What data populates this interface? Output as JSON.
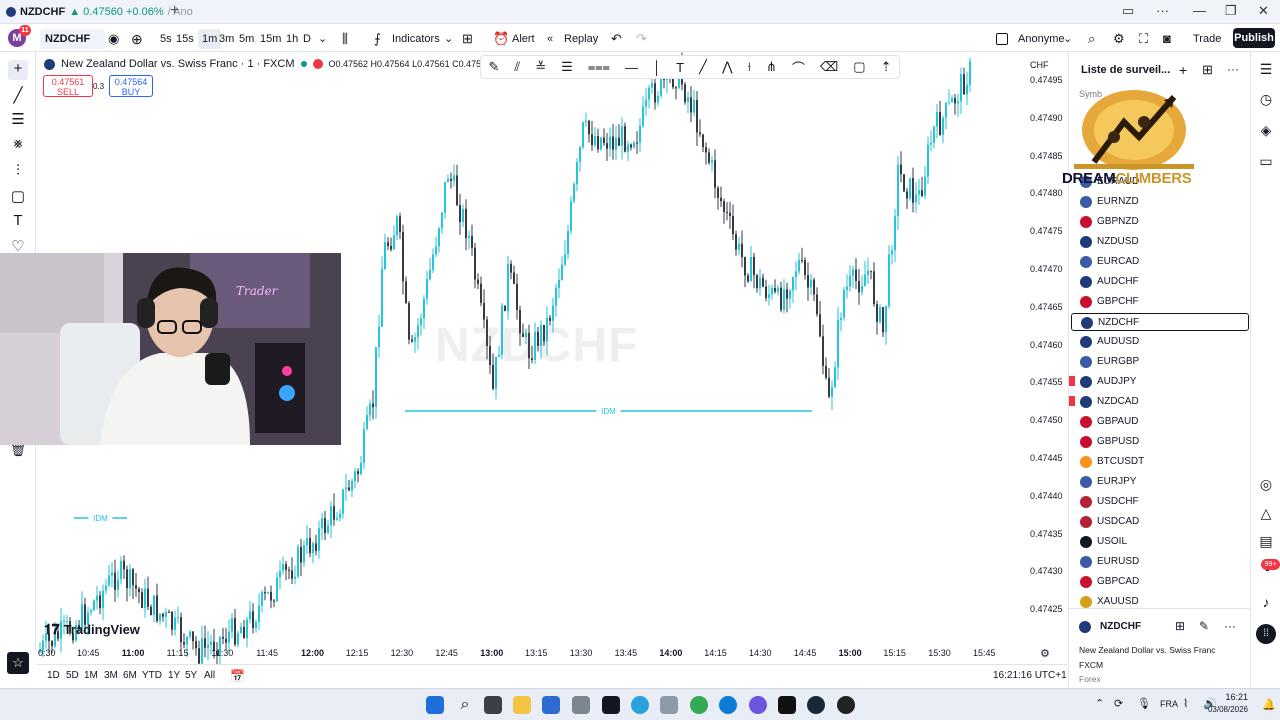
{
  "browser": {
    "tab_symbol": "NZDCHF",
    "tab_change": "▲ 0.47560 +0.06%",
    "tab_suffix": "/ Ano"
  },
  "toolbar": {
    "avatar_letter": "M",
    "avatar_badge": "11",
    "symbol": "NZDCHF",
    "intervals": [
      "5s",
      "15s",
      "1m",
      "3m",
      "5m",
      "15m",
      "1h",
      "D"
    ],
    "selected_interval": "1m",
    "indicators_label": "Indicators",
    "alert_label": "Alert",
    "replay_label": "Replay",
    "layout_name": "Anonyme",
    "trade_label": "Trade",
    "publish_label": "Publish"
  },
  "legend": {
    "title": "New Zealand Dollar vs. Swiss Franc · 1 · FXCM",
    "ohlc": "O0.47562 H0.47564 L0.47561 C0.47561 -0",
    "sell_price": "0.47561",
    "sell_label": "SELL",
    "spread": "0.3",
    "buy_price": "0.47564",
    "buy_label": "BUY"
  },
  "chart": {
    "watermark": "NZDCHF",
    "currency": "CHF",
    "price_labels": [
      "0.47495",
      "0.47490",
      "0.47485",
      "0.47480",
      "0.47475",
      "0.47470",
      "0.47465",
      "0.47460",
      "0.47455",
      "0.47450",
      "0.47445",
      "0.47440",
      "0.47435",
      "0.47430",
      "0.47425"
    ],
    "time_labels": [
      "0:30",
      "10:45",
      "11:00",
      "11:15",
      "11:30",
      "11:45",
      "12:00",
      "12:15",
      "12:30",
      "12:45",
      "13:00",
      "13:15",
      "13:30",
      "13:45",
      "14:00",
      "14:15",
      "14:30",
      "14:45",
      "15:00",
      "15:15",
      "15:30",
      "15:45"
    ],
    "idm_label_1": "IDM",
    "idm_label_2": "IDM",
    "brand": "TradingView",
    "bull_color": "#26c6da",
    "bear_color": "#363a45"
  },
  "bottombar": {
    "ranges": [
      "1D",
      "5D",
      "1M",
      "3M",
      "6M",
      "YTD",
      "1Y",
      "5Y",
      "All"
    ],
    "clock": "16:21:16 UTC+1"
  },
  "watchlist": {
    "title": "Liste de surveil...",
    "symbol_header": "Symb",
    "items": [
      {
        "symbol": "EURAUD",
        "flag": "#3b5ba5",
        "marked": false
      },
      {
        "symbol": "EURNZD",
        "flag": "#3b5ba5",
        "marked": false
      },
      {
        "symbol": "GBPNZD",
        "flag": "#c8102e",
        "marked": false
      },
      {
        "symbol": "NZDUSD",
        "flag": "#1f3b7a",
        "marked": false
      },
      {
        "symbol": "EURCAD",
        "flag": "#3b5ba5",
        "marked": false
      },
      {
        "symbol": "AUDCHF",
        "flag": "#1f3b7a",
        "marked": false
      },
      {
        "symbol": "GBPCHF",
        "flag": "#c8102e",
        "marked": false
      },
      {
        "symbol": "NZDCHF",
        "flag": "#1f3b7a",
        "marked": false
      },
      {
        "symbol": "AUDUSD",
        "flag": "#1f3b7a",
        "marked": false
      },
      {
        "symbol": "EURGBP",
        "flag": "#3b5ba5",
        "marked": false
      },
      {
        "symbol": "AUDJPY",
        "flag": "#1f3b7a",
        "marked": true
      },
      {
        "symbol": "NZDCAD",
        "flag": "#1f3b7a",
        "marked": true
      },
      {
        "symbol": "GBPAUD",
        "flag": "#c8102e",
        "marked": false
      },
      {
        "symbol": "GBPUSD",
        "flag": "#c8102e",
        "marked": false
      },
      {
        "symbol": "BTCUSDT",
        "flag": "#f7931a",
        "marked": false
      },
      {
        "symbol": "EURJPY",
        "flag": "#3b5ba5",
        "marked": false
      },
      {
        "symbol": "USDCHF",
        "flag": "#b22234",
        "marked": false
      },
      {
        "symbol": "USDCAD",
        "flag": "#b22234",
        "marked": false
      },
      {
        "symbol": "USOIL",
        "flag": "#131722",
        "marked": false
      },
      {
        "symbol": "EURUSD",
        "flag": "#3b5ba5",
        "marked": false
      },
      {
        "symbol": "GBPCAD",
        "flag": "#c8102e",
        "marked": false
      },
      {
        "symbol": "XAUUSD",
        "flag": "#d4a017",
        "marked": false
      }
    ],
    "active_symbol": "NZDCHF"
  },
  "detail": {
    "symbol": "NZDCHF",
    "name": "New Zealand Dollar vs. Swiss Franc",
    "exchange": "FXCM",
    "type": "Forex"
  },
  "overlay": {
    "brand_part1": "DREAM",
    "brand_part2": "CLIMBERS"
  },
  "right_strip": {
    "notification_badge": "99+"
  },
  "taskbar": {
    "lang": "FRA",
    "time": "16:21",
    "date": "03/08/2026"
  }
}
